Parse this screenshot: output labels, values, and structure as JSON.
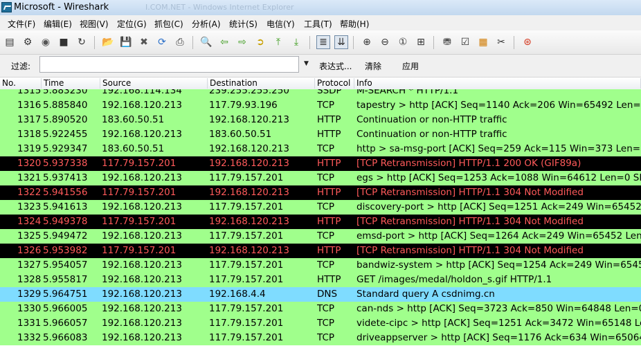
{
  "window": {
    "title": "Microsoft - Wireshark",
    "ghost_title": "I.COM.NET - Windows Internet Explorer"
  },
  "menu": [
    {
      "label": "文件(F)"
    },
    {
      "label": "编辑(E)"
    },
    {
      "label": "视图(V)"
    },
    {
      "label": "定位(G)"
    },
    {
      "label": "抓包(C)"
    },
    {
      "label": "分析(A)"
    },
    {
      "label": "统计(S)"
    },
    {
      "label": "电信(Y)"
    },
    {
      "label": "工具(T)"
    },
    {
      "label": "帮助(H)"
    }
  ],
  "toolbar": {
    "icons": [
      "interface-list-icon",
      "capture-options-icon",
      "start-capture-icon",
      "stop-capture-icon",
      "restart-capture-icon",
      "open-file-icon",
      "save-file-icon",
      "close-file-icon",
      "reload-icon",
      "print-icon",
      "find-packet-icon",
      "go-back-icon",
      "go-forward-icon",
      "go-to-packet-icon",
      "go-first-icon",
      "go-last-icon",
      "colorize-icon",
      "auto-scroll-icon",
      "zoom-in-icon",
      "zoom-out-icon",
      "normal-size-icon",
      "resize-columns-icon",
      "capture-filters-icon",
      "display-filters-icon",
      "coloring-rules-icon",
      "preferences-icon",
      "help-icon"
    ]
  },
  "filter": {
    "label": "过滤:",
    "value": "",
    "expression_label": "表达式...",
    "clear_label": "清除",
    "apply_label": "应用"
  },
  "columns": [
    "No.",
    "Time",
    "Source",
    "Destination",
    "Protocol",
    "Info"
  ],
  "colors": {
    "tcp_bg": "#a0ff8c",
    "http_bg": "#a0ff8c",
    "dns_bg": "#7fdcff",
    "bad_bg": "#000000",
    "bad_fg": "#ff5a5a"
  },
  "packets": [
    {
      "no": "1315",
      "time": "5.883230",
      "src": "192.168.114.134",
      "dst": "239.255.255.250",
      "proto": "SSDP",
      "info": "M-SEARCH * HTTP/1.1",
      "style": "tcp"
    },
    {
      "no": "1316",
      "time": "5.885840",
      "src": "192.168.120.213",
      "dst": "117.79.93.196",
      "proto": "TCP",
      "info": "tapestry > http [ACK] Seq=1140 Ack=206 Win=65492 Len=0",
      "style": "tcp"
    },
    {
      "no": "1317",
      "time": "5.890520",
      "src": "183.60.50.51",
      "dst": "192.168.120.213",
      "proto": "HTTP",
      "info": "Continuation or non-HTTP traffic",
      "style": "http"
    },
    {
      "no": "1318",
      "time": "5.922455",
      "src": "192.168.120.213",
      "dst": "183.60.50.51",
      "proto": "HTTP",
      "info": "Continuation or non-HTTP traffic",
      "style": "http"
    },
    {
      "no": "1319",
      "time": "5.929347",
      "src": "183.60.50.51",
      "dst": "192.168.120.213",
      "proto": "TCP",
      "info": "http > sa-msg-port [ACK] Seq=259 Ack=115 Win=373 Len=0",
      "style": "tcp"
    },
    {
      "no": "1320",
      "time": "5.937338",
      "src": "117.79.157.201",
      "dst": "192.168.120.213",
      "proto": "HTTP",
      "info": "[TCP Retransmission] HTTP/1.1 200 OK  (GIF89a)",
      "style": "bad"
    },
    {
      "no": "1321",
      "time": "5.937413",
      "src": "192.168.120.213",
      "dst": "117.79.157.201",
      "proto": "TCP",
      "info": "egs > http [ACK] Seq=1253 Ack=1088 Win=64612 Len=0 SLE",
      "style": "tcp"
    },
    {
      "no": "1322",
      "time": "5.941556",
      "src": "117.79.157.201",
      "dst": "192.168.120.213",
      "proto": "HTTP",
      "info": "[TCP Retransmission] HTTP/1.1 304 Not Modified",
      "style": "bad"
    },
    {
      "no": "1323",
      "time": "5.941613",
      "src": "192.168.120.213",
      "dst": "117.79.157.201",
      "proto": "TCP",
      "info": "discovery-port > http [ACK] Seq=1251 Ack=249 Win=65452 L",
      "style": "tcp"
    },
    {
      "no": "1324",
      "time": "5.949378",
      "src": "117.79.157.201",
      "dst": "192.168.120.213",
      "proto": "HTTP",
      "info": "[TCP Retransmission] HTTP/1.1 304 Not Modified",
      "style": "bad"
    },
    {
      "no": "1325",
      "time": "5.949472",
      "src": "192.168.120.213",
      "dst": "117.79.157.201",
      "proto": "TCP",
      "info": "emsd-port > http [ACK] Seq=1264 Ack=249 Win=65452 Len=0",
      "style": "tcp"
    },
    {
      "no": "1326",
      "time": "5.953982",
      "src": "117.79.157.201",
      "dst": "192.168.120.213",
      "proto": "HTTP",
      "info": "[TCP Retransmission] HTTP/1.1 304 Not Modified",
      "style": "bad"
    },
    {
      "no": "1327",
      "time": "5.954057",
      "src": "192.168.120.213",
      "dst": "117.79.157.201",
      "proto": "TCP",
      "info": "bandwiz-system > http [ACK] Seq=1254 Ack=249 Win=65452",
      "style": "tcp"
    },
    {
      "no": "1328",
      "time": "5.955817",
      "src": "192.168.120.213",
      "dst": "117.79.157.201",
      "proto": "HTTP",
      "info": "GET /images/medal/holdon_s.gif HTTP/1.1",
      "style": "http"
    },
    {
      "no": "1329",
      "time": "5.964751",
      "src": "192.168.120.213",
      "dst": "192.168.4.4",
      "proto": "DNS",
      "info": "Standard query A csdnimg.cn",
      "style": "dns"
    },
    {
      "no": "1330",
      "time": "5.966005",
      "src": "192.168.120.213",
      "dst": "117.79.157.201",
      "proto": "TCP",
      "info": "can-nds > http [ACK] Seq=3723 Ack=850 Win=64848 Len=0",
      "style": "tcp"
    },
    {
      "no": "1331",
      "time": "5.966057",
      "src": "192.168.120.213",
      "dst": "117.79.157.201",
      "proto": "TCP",
      "info": "videte-cipc > http [ACK] Seq=1251 Ack=3472 Win=65148 Len",
      "style": "tcp"
    },
    {
      "no": "1332",
      "time": "5.966083",
      "src": "192.168.120.213",
      "dst": "117.79.157.201",
      "proto": "TCP",
      "info": "driveappserver > http [ACK] Seq=1176 Ack=634 Win=65064 L",
      "style": "tcp"
    }
  ]
}
